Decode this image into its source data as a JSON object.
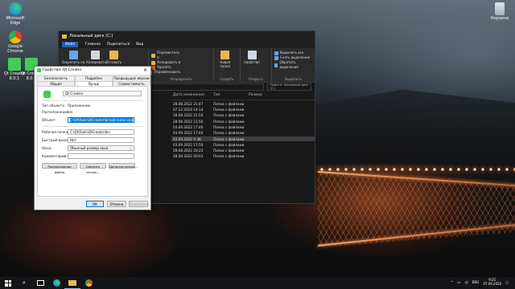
{
  "desktop_icons": [
    {
      "label": "Microsoft Edge",
      "icon": "edge-icon",
      "color": "#1a9bd7"
    },
    {
      "label": "Google Chrome",
      "icon": "chrome-icon",
      "color": "#e34133"
    },
    {
      "label": "Qt Creator 8.0.1",
      "icon": "qt-icon",
      "color": "#41cd52"
    },
    {
      "label": "Qt Creator 8.0.1",
      "icon": "qt-icon",
      "color": "#41cd52"
    },
    {
      "label": "Корзина",
      "icon": "recycle-bin-icon",
      "color": "#c8d3de"
    }
  ],
  "explorer": {
    "title": "Локальный диск (C:)",
    "menu": [
      "Файл",
      "Главная",
      "Поделиться",
      "Вид"
    ],
    "ribbon": {
      "clipboard": {
        "pin": "Закрепить на панели быстрого доступа",
        "copy": "Копировать",
        "paste": "Вставить",
        "cut": "Вырезать",
        "copy_path": "Скопировать путь",
        "paste_shortcut": "Вставить ярлык",
        "caption": "Буфер обмена"
      },
      "organize": {
        "move": "Переместить в",
        "copy": "Копировать в",
        "delete": "Удалить",
        "rename": "Переименовать",
        "caption": "Упорядочить"
      },
      "new": {
        "new_folder": "Новая папка",
        "caption": "Создать"
      },
      "open": {
        "properties": "Свойства",
        "open": "Открыть",
        "caption": "Открыть"
      },
      "select": {
        "select_all": "Выделить все",
        "select_none": "Снять выделение",
        "invert": "Обратить выделение",
        "caption": "Выделить"
      }
    },
    "path": "C:\\",
    "search_placeholder": "Поиск в: Локальный диск (C:)",
    "columns": [
      "Дата изменения",
      "Тип",
      "Размер"
    ],
    "rows": [
      {
        "date": "28.08.2022 21:47",
        "type": "Папка с файлами",
        "size": "",
        "selected": false
      },
      {
        "date": "07.12.2019 14:14",
        "type": "Папка с файлами",
        "size": "",
        "selected": false
      },
      {
        "date": "28.08.2022 21:50",
        "type": "Папка с файлами",
        "size": "",
        "selected": false
      },
      {
        "date": "28.08.2022 21:50",
        "type": "Папка с файлами",
        "size": "",
        "selected": false
      },
      {
        "date": "03.09.2022 17:40",
        "type": "Папка с файлами",
        "size": "",
        "selected": false
      },
      {
        "date": "03.09.2022 17:40",
        "type": "Папка с файлами",
        "size": "",
        "selected": false
      },
      {
        "date": "03.09.2022 9:38",
        "type": "Папка с файлами",
        "size": "",
        "selected": true
      },
      {
        "date": "03.09.2022 17:50",
        "type": "Папка с файлами",
        "size": "",
        "selected": false
      },
      {
        "date": "28.08.2022 20:23",
        "type": "Папка с файлами",
        "size": "",
        "selected": false
      },
      {
        "date": "28.08.2022 20:03",
        "type": "Папка с файлами",
        "size": "",
        "selected": false
      }
    ]
  },
  "props": {
    "title": "Свойства: Qt Creator",
    "tabs_row1": [
      "Безопасность",
      "Подробно",
      "Предыдущие версии"
    ],
    "tabs_row2": [
      "Общие",
      "Ярлык",
      "Совместимость"
    ],
    "name": "Qt Creator",
    "type_label": "Тип объекта:",
    "type_value": "Приложение",
    "location_label": "Расположение:",
    "location_value": "bin",
    "target_label": "Объект:",
    "target_value": "C:\\Qt\\Tools\\QtCreator\\bin\\qtcreator.exe",
    "workdir_label": "Рабочая папка:",
    "workdir_value": "C:\\Qt\\Tools\\QtCreator\\bin",
    "hotkey_label": "Быстрый вызов:",
    "hotkey_value": "Нет",
    "window_label": "Окно:",
    "window_value": "Обычный размер окна",
    "comment_label": "Комментарий:",
    "comment_value": "",
    "btn_location": "Расположение файла",
    "btn_icon": "Сменить значок...",
    "btn_advanced": "Дополнительно...",
    "ok": "ОК",
    "cancel": "Отмена",
    "apply": "Применить"
  },
  "taskbar": {
    "lang": "ENG",
    "time": "9:21",
    "date": "07.09.2022"
  }
}
